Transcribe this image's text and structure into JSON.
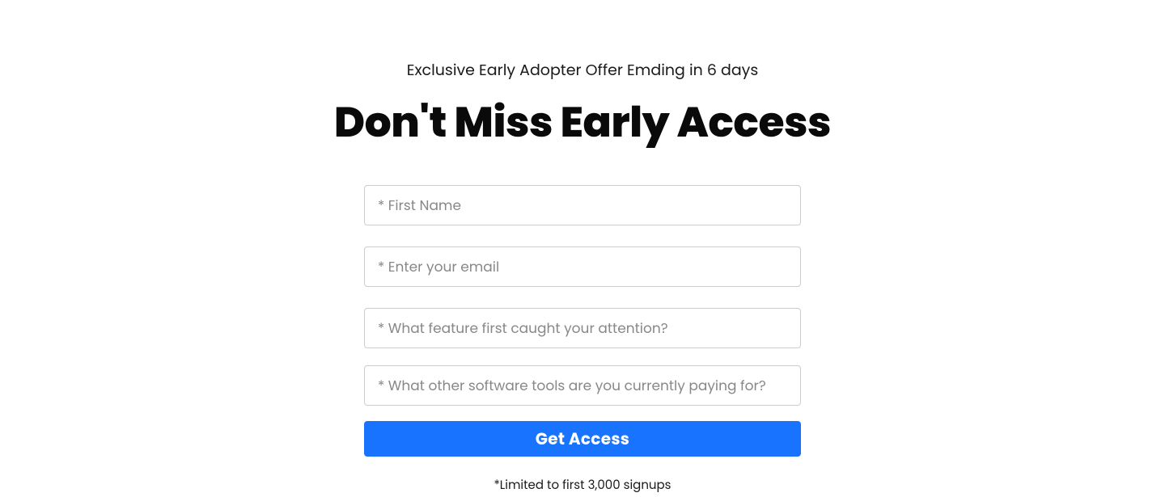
{
  "header": {
    "subtitle": "Exclusive Early Adopter Offer Emding in 6 days",
    "title": "Don't Miss Early Access"
  },
  "form": {
    "first_name_placeholder": "* First Name",
    "email_placeholder": "* Enter your email",
    "feature_placeholder": "* What feature first caught your attention?",
    "tools_placeholder": "* What other software tools are you currently paying for?",
    "submit_label": "Get Access"
  },
  "footnote": "*Limited to first 3,000 signups"
}
